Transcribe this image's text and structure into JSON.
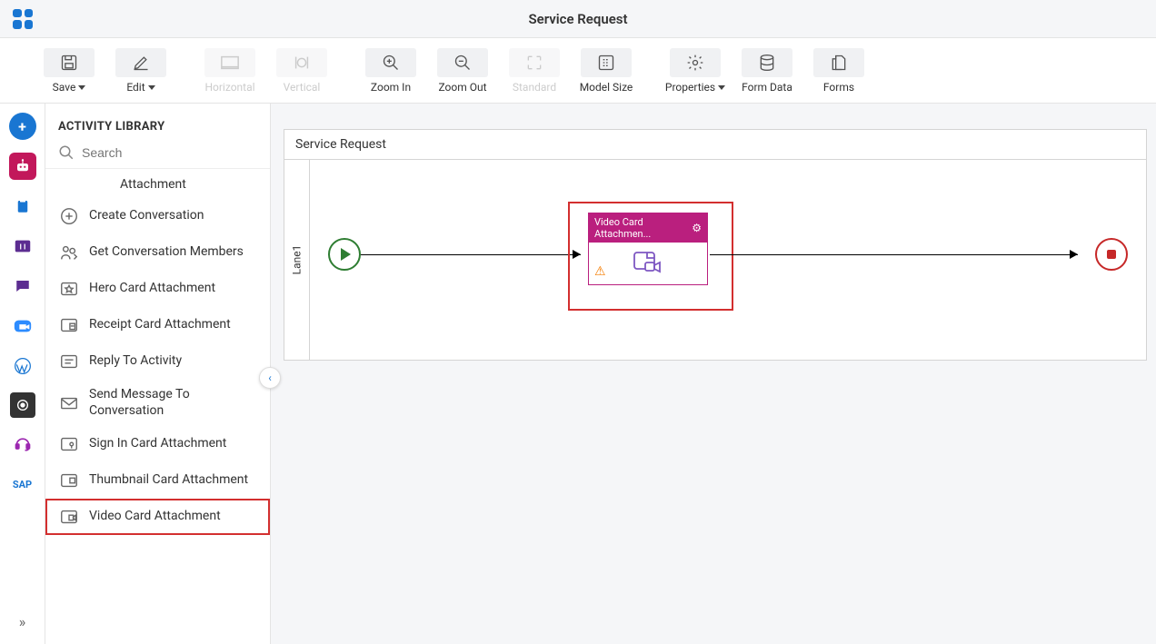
{
  "header": {
    "title": "Service Request"
  },
  "toolbar": {
    "save": "Save",
    "edit": "Edit",
    "horizontal": "Horizontal",
    "vertical": "Vertical",
    "zoom_in": "Zoom In",
    "zoom_out": "Zoom Out",
    "standard": "Standard",
    "model_size": "Model Size",
    "properties": "Properties",
    "form_data": "Form Data",
    "forms": "Forms"
  },
  "sidepanel": {
    "title": "ACTIVITY LIBRARY",
    "search_placeholder": "Search"
  },
  "rail": {
    "sap_label": "SAP"
  },
  "library": {
    "partial": "Attachment",
    "items": [
      "Create Conversation",
      "Get Conversation Members",
      "Hero Card Attachment",
      "Receipt Card Attachment",
      "Reply To Activity",
      "Send Message To Conversation",
      "Sign In Card Attachment",
      "Thumbnail Card Attachment",
      "Video Card Attachment"
    ]
  },
  "canvas": {
    "title": "Service Request",
    "lane": "Lane1",
    "node_label": "Video Card Attachmen..."
  }
}
